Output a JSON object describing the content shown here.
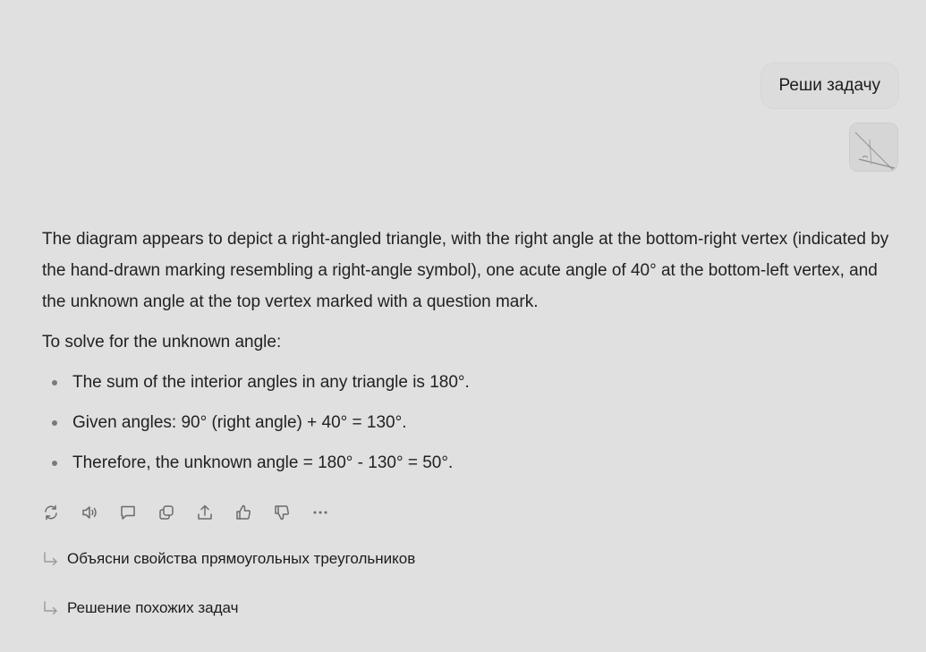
{
  "conversation": {
    "user_message": "Реши задачу",
    "user_attachment": "triangle-sketch-thumbnail"
  },
  "answer": {
    "intro": "The diagram appears to depict a right-angled triangle, with the right angle at the bottom-right vertex (indicated by the hand-drawn marking resembling a right-angle symbol), one acute angle of 40° at the bottom-left vertex, and the unknown angle at the top vertex marked with a question mark.",
    "lead": "To solve for the unknown angle:",
    "bullets": [
      "The sum of the interior angles in any triangle is 180°.",
      "Given angles: 90° (right angle) + 40° = 130°.",
      "Therefore, the unknown angle = 180° - 130° = 50°."
    ]
  },
  "actions": [
    {
      "icon": "regenerate-icon"
    },
    {
      "icon": "speaker-icon"
    },
    {
      "icon": "comment-icon"
    },
    {
      "icon": "copy-icon"
    },
    {
      "icon": "share-icon"
    },
    {
      "icon": "thumbs-up-icon"
    },
    {
      "icon": "thumbs-down-icon"
    },
    {
      "icon": "more-icon"
    }
  ],
  "suggestions": [
    "Объясни свойства прямоугольных треугольников",
    "Решение похожих задач"
  ],
  "colors": {
    "background": "#e0e0e0",
    "bubble": "#dcdcdc",
    "text": "#222222",
    "icon": "#6b6b6b"
  }
}
